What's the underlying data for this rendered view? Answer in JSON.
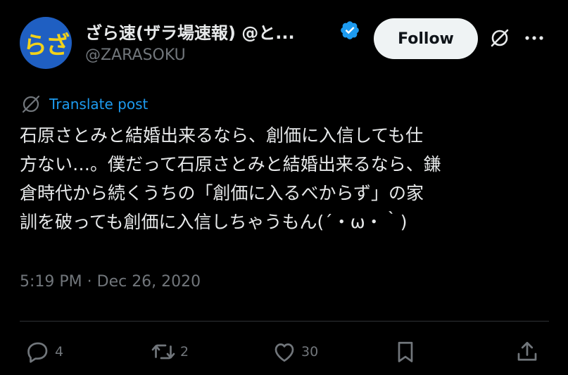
{
  "author": {
    "avatar_text": "らざ",
    "display_name": "ざら速(ザラ場速報) @と...",
    "handle": "@ZARASOKU",
    "verified_icon": "verified-badge-icon"
  },
  "header": {
    "follow_label": "Follow",
    "grok_icon": "grok-icon",
    "more_icon": "more-options-icon"
  },
  "translate": {
    "icon": "translate-globe-icon",
    "label": "Translate post"
  },
  "post": {
    "lines": [
      "石原さとみと結婚出来るなら、創価に入信しても仕",
      "方ない…。僕だって石原さとみと結婚出来るなら、鎌",
      "倉時代から続くうちの「創価に入るべからず」の家",
      "訓を破っても創価に入信しちゃうもん(´・ω・｀)"
    ],
    "timestamp": "5:19 PM · Dec 26, 2020"
  },
  "actions": {
    "replies": "4",
    "reposts": "2",
    "likes": "30"
  },
  "colors": {
    "background": "#000000",
    "text": "#e7e9ea",
    "muted": "#71767b",
    "accent": "#1d9bf0",
    "avatar_bg": "#1f5fc2",
    "avatar_text": "#f2d21a"
  }
}
